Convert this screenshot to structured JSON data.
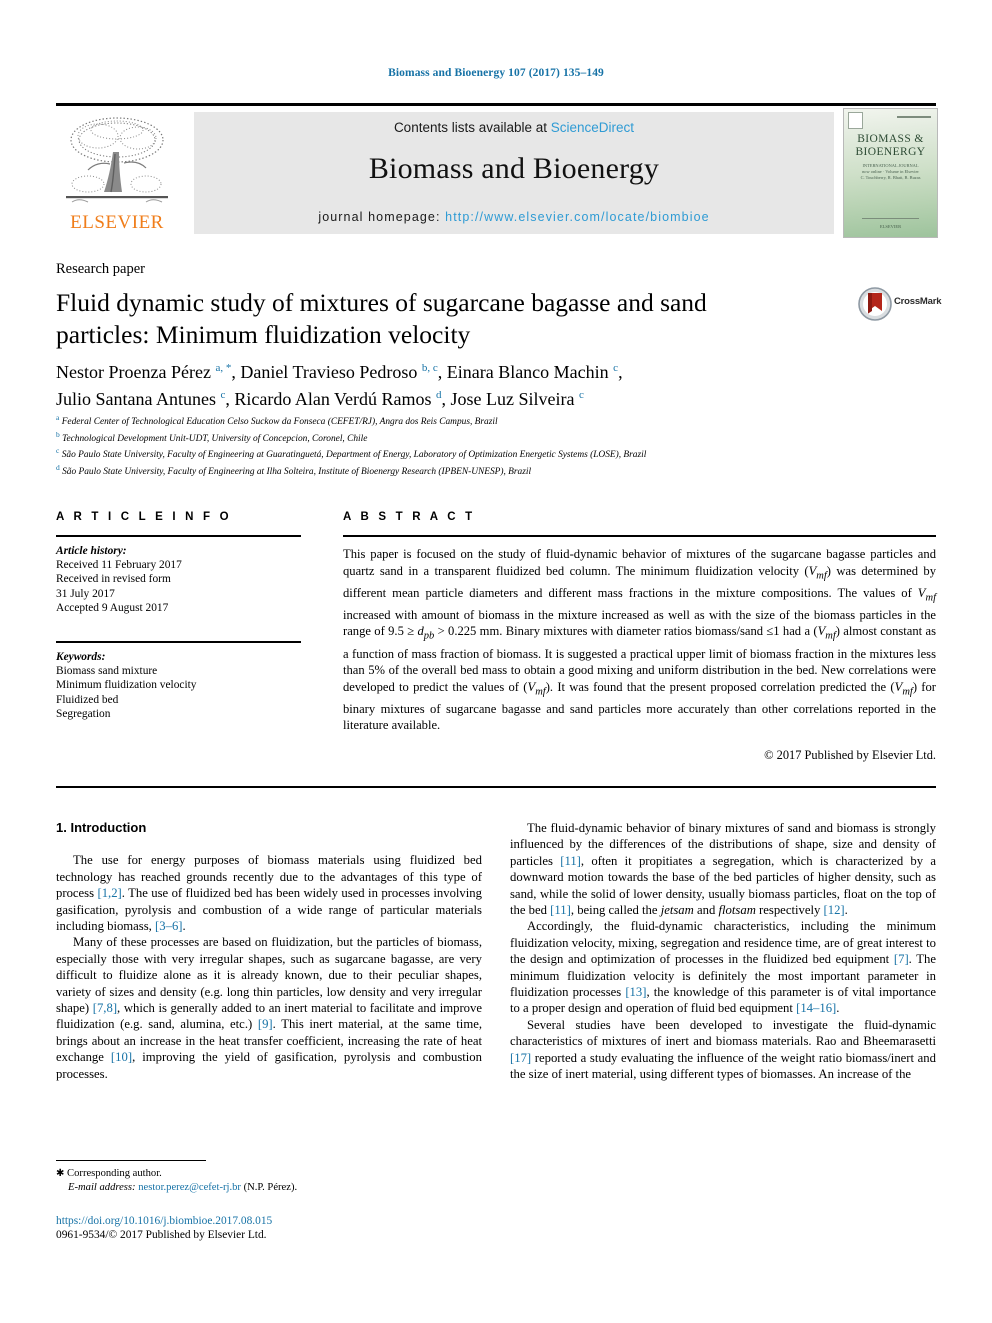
{
  "running_head": "Biomass and Bioenergy 107 (2017) 135–149",
  "masthead": {
    "contents_prefix": "Contents lists available at ",
    "sciencedirect": "ScienceDirect",
    "journal_title": "Biomass and Bioenergy",
    "homepage_prefix": "journal homepage: ",
    "homepage_url": "http://www.elsevier.com/locate/biombioe",
    "publisher_logo_text": "ELSEVIER",
    "cover": {
      "title_line1": "BIOMASS &",
      "title_line2": "BIOENERGY",
      "subtitle": "INTERNATIONAL JOURNAL",
      "sub_line2": "now online · Volume in Elsevier",
      "sub_line3": "C. Touchberry, R. Bhatt, B. Buzas",
      "bottom": "ELSEVIER"
    },
    "link_color": "#2f9bd4"
  },
  "article_type": "Research paper",
  "title": "Fluid dynamic study of mixtures of sugarcane bagasse and sand particles: Minimum fluidization velocity",
  "crossmark_label": "CrossMark",
  "authors_line1": "Nestor Proenza Pérez <sup>a, *</sup>, Daniel Travieso Pedroso <sup>b, c</sup>, Einara Blanco Machin <sup>c</sup>,",
  "authors_line2": "Julio Santana Antunes <sup>c</sup>, Ricardo Alan Verdú Ramos <sup>d</sup>, Jose Luz Silveira <sup>c</sup>",
  "affiliations": [
    "<sup>a</sup> Federal Center of Technological Education Celso Suckow da Fonseca (CEFET/RJ), Angra dos Reis Campus, Brazil",
    "<sup>b</sup> Technological Development Unit-UDT, University of Concepcion, Coronel, Chile",
    "<sup>c</sup> São Paulo State University, Faculty of Engineering at Guaratinguetá, Department of Energy, Laboratory of Optimization Energetic Systems (LOSE), Brazil",
    "<sup>d</sup> São Paulo State University, Faculty of Engineering at Ilha Solteira, Institute of Bioenergy Research (IPBEN-UNESP), Brazil"
  ],
  "article_info": {
    "heading": "A R T I C L E  I N F O",
    "history_label": "Article history:",
    "history_lines": [
      "Received 11 February 2017",
      "Received in revised form",
      "31 July 2017",
      "Accepted 9 August 2017"
    ],
    "keywords_label": "Keywords:",
    "keywords": [
      "Biomass sand mixture",
      "Minimum fluidization velocity",
      "Fluidized bed",
      "Segregation"
    ]
  },
  "abstract": {
    "heading": "A B S T R A C T",
    "text": "This paper is focused on the study of fluid-dynamic behavior of mixtures of the sugarcane bagasse particles and quartz sand in a transparent fluidized bed column. The minimum fluidization velocity (<i>V<sub>mf</sub></i>) was determined by different mean particle diameters and different mass fractions in the mixture compositions. The values of <i>V<sub>mf</sub></i> increased with amount of biomass in the mixture increased as well as with the size of the biomass particles in the range of 9.5 ≥ <i>d<sub>pb</sub></i> &gt; 0.225 mm. Binary mixtures with diameter ratios biomass/sand ≤1 had a (<i>V<sub>mf</sub></i>) almost constant as a function of mass fraction of biomass. It is suggested a practical upper limit of biomass fraction in the mixtures less than 5% of the overall bed mass to obtain a good mixing and uniform distribution in the bed. New correlations were developed to predict the values of (<i>V<sub>mf</sub></i>). It was found that the present proposed correlation predicted the (<i>V<sub>mf</sub></i>) for binary mixtures of sugarcane bagasse and sand particles more accurately than other correlations reported in the literature available.",
    "copyright": "© 2017 Published by Elsevier Ltd."
  },
  "body": {
    "section_heading": "1.  Introduction",
    "left_paragraphs": [
      "The use for energy purposes of biomass materials using fluidized bed technology has reached grounds recently due to the advantages of this type of process <span class=\"ref\">[1,2]</span>. The use of fluidized bed has been widely used in processes involving gasification, pyrolysis and combustion of a wide range of particular materials including biomass, <span class=\"ref\">[3–6]</span>.",
      "Many of these processes are based on fluidization, but the particles of biomass, especially those with very irregular shapes, such as sugarcane bagasse, are very difficult to fluidize alone as it is already known, due to their peculiar shapes, variety of sizes and density (e.g. long thin particles, low density and very irregular shape) <span class=\"ref\">[7,8]</span>, which is generally added to an inert material to facilitate and improve fluidization (e.g. sand, alumina, etc.) <span class=\"ref\">[9]</span>. This inert material, at the same time, brings about an increase in the heat transfer coefficient, increasing the rate of heat exchange <span class=\"ref\">[10]</span>, improving the yield of gasification, pyrolysis and combustion processes."
    ],
    "right_paragraphs": [
      "The fluid-dynamic behavior of binary mixtures of sand and biomass is strongly influenced by the differences of the distributions of shape, size and density of particles <span class=\"ref\">[11]</span>, often it propitiates a segregation, which is characterized by a downward motion towards the base of the bed particles of higher density, such as sand, while the solid of lower density, usually biomass particles, float on the top of the bed <span class=\"ref\">[11]</span>, being called the <i>jetsam</i> and <i>flotsam</i> respectively <span class=\"ref\">[12]</span>.",
      "Accordingly, the fluid-dynamic characteristics, including the minimum fluidization velocity, mixing, segregation and residence time, are of great interest to the design and optimization of processes in the fluidized bed equipment <span class=\"ref\">[7]</span>. The minimum fluidization velocity is definitely the most important parameter in fluidization processes <span class=\"ref\">[13]</span>, the knowledge of this parameter is of vital importance to a proper design and operation of fluid bed equipment <span class=\"ref\">[14–16]</span>.",
      "Several studies have been developed to investigate the fluid-dynamic characteristics of mixtures of inert and biomass materials. Rao and Bheemarasetti <span class=\"ref\">[17]</span> reported a study evaluating the influence of the weight ratio biomass/inert and the size of inert material, using different types of biomasses. An increase of the"
    ]
  },
  "footnotes": {
    "corresponding": "Corresponding author.",
    "email_label": "E-mail address:",
    "email": "nestor.perez@cefet-rj.br",
    "email_suffix": " (N.P. Pérez).",
    "doi": "https://doi.org/10.1016/j.biombioe.2017.08.015",
    "issn_line": "0961-9534/© 2017 Published by Elsevier Ltd."
  }
}
